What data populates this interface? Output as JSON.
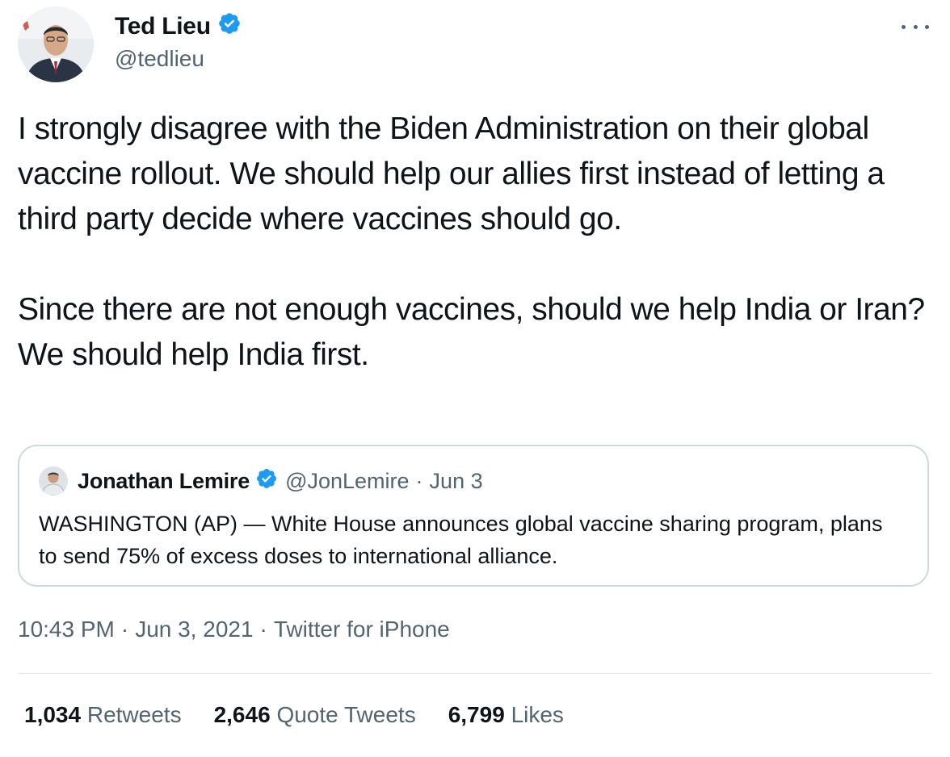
{
  "author": {
    "name": "Ted Lieu",
    "handle": "@tedlieu",
    "verified": true
  },
  "tweet": {
    "paragraphs": [
      "I strongly disagree with the Biden Administration on their global vaccine rollout. We should help our allies first instead of letting a third party decide where vaccines should go.",
      "Since there are not enough vaccines, should we help India or Iran? We should help India first."
    ]
  },
  "quoted_tweet": {
    "name": "Jonathan Lemire",
    "handle": "@JonLemire",
    "separator": "·",
    "date": "Jun 3",
    "verified": true,
    "text": "WASHINGTON (AP) — White House announces global vaccine sharing program, plans to send 75% of excess doses to international alliance."
  },
  "meta": {
    "time": "10:43 PM",
    "separator": "·",
    "date": "Jun 3, 2021",
    "source": "Twitter for iPhone"
  },
  "stats": {
    "retweets": {
      "count": "1,034",
      "label": "Retweets"
    },
    "quote_tweets": {
      "count": "2,646",
      "label": "Quote Tweets"
    },
    "likes": {
      "count": "6,799",
      "label": "Likes"
    }
  },
  "colors": {
    "verified": "#1d9bf0",
    "secondary_text": "#536471",
    "primary_text": "#0f1419",
    "border": "#cfd9de"
  },
  "icons": {
    "verified": "verified-badge-icon",
    "more": "more-options-icon"
  }
}
